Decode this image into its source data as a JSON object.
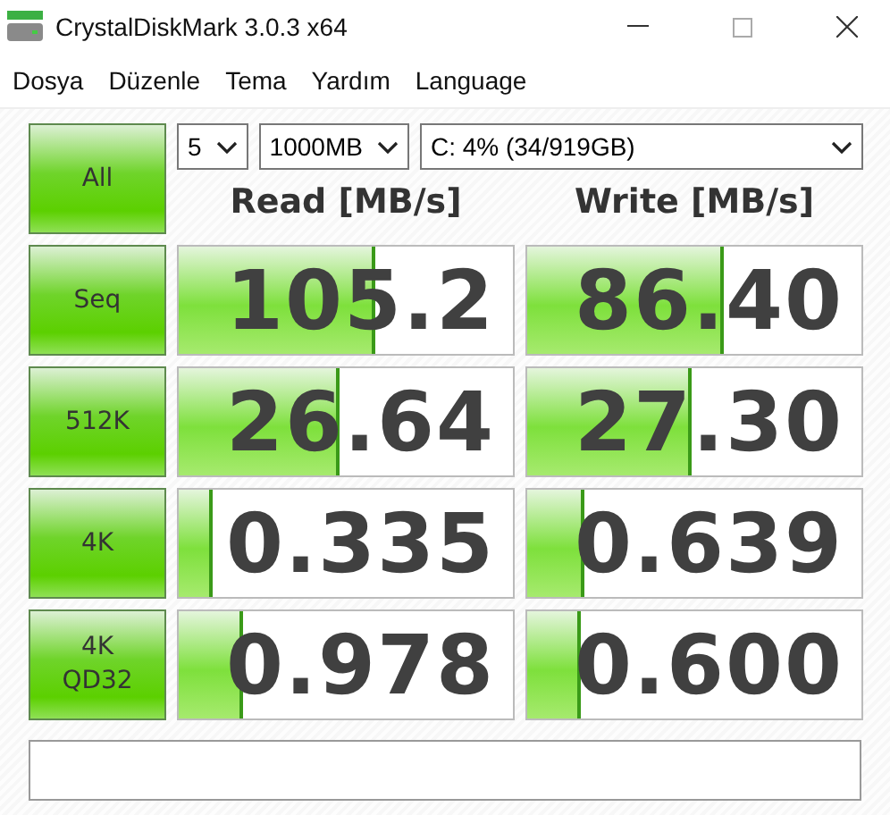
{
  "window": {
    "title": "CrystalDiskMark 3.0.3 x64"
  },
  "menu": [
    "Dosya",
    "Düzenle",
    "Tema",
    "Yardım",
    "Language"
  ],
  "all_button": "All",
  "selects": [
    {
      "value": "5"
    },
    {
      "value": "1000MB"
    },
    {
      "value": "C: 4% (34/919GB)"
    }
  ],
  "headers": [
    "Read [MB/s]",
    "Write [MB/s]"
  ],
  "rows": [
    {
      "label": [
        "Seq"
      ],
      "read": {
        "value": "105.2",
        "level": 0.59
      },
      "write": {
        "value": "86.40",
        "level": 0.59
      }
    },
    {
      "label": [
        "512K"
      ],
      "read": {
        "value": "26.64",
        "level": 0.48
      },
      "write": {
        "value": "27.30",
        "level": 0.49
      }
    },
    {
      "label": [
        "4K"
      ],
      "read": {
        "value": "0.335",
        "level": 0.1
      },
      "write": {
        "value": "0.639",
        "level": 0.17
      }
    },
    {
      "label": [
        "4K",
        "QD32"
      ],
      "read": {
        "value": "0.978",
        "level": 0.19
      },
      "write": {
        "value": "0.600",
        "level": 0.16
      }
    }
  ]
}
